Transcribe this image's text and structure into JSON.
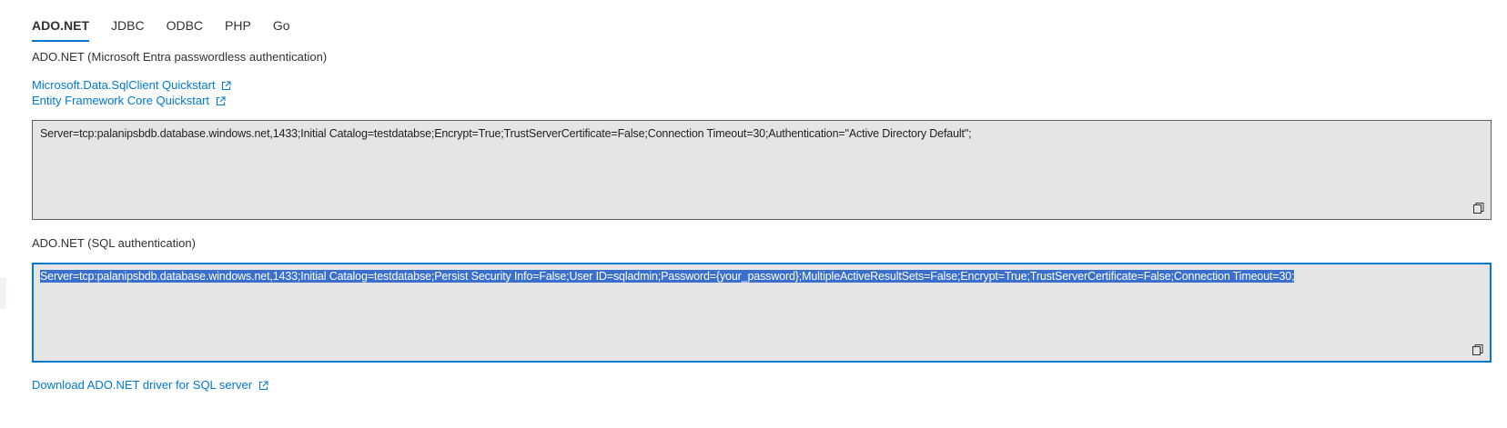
{
  "tabs": [
    {
      "label": "ADO.NET",
      "active": true
    },
    {
      "label": "JDBC",
      "active": false
    },
    {
      "label": "ODBC",
      "active": false
    },
    {
      "label": "PHP",
      "active": false
    },
    {
      "label": "Go",
      "active": false
    }
  ],
  "section1": {
    "heading": "ADO.NET (Microsoft Entra passwordless authentication)",
    "links": [
      {
        "label": "Microsoft.Data.SqlClient Quickstart",
        "icon": "external-link-icon"
      },
      {
        "label": "Entity Framework Core Quickstart",
        "icon": "external-link-icon"
      }
    ],
    "connection_string": "Server=tcp:palanipsbdb.database.windows.net,1433;Initial Catalog=testdatabse;Encrypt=True;TrustServerCertificate=False;Connection Timeout=30;Authentication=\"Active Directory Default\";",
    "copy_icon": "copy-icon"
  },
  "section2": {
    "heading": "ADO.NET (SQL authentication)",
    "connection_string": "Server=tcp:palanipsbdb.database.windows.net,1433;Initial Catalog=testdatabse;Persist Security Info=False;User ID=sqladmin;Password={your_password};MultipleActiveResultSets=False;Encrypt=True;TrustServerCertificate=False;Connection Timeout=30;",
    "selected": true,
    "copy_icon": "copy-icon"
  },
  "footer": {
    "download_link": "Download ADO.NET driver for SQL server",
    "icon": "external-link-icon"
  },
  "colors": {
    "accent": "#0078d4",
    "selection": "#3b6fce",
    "box_bg": "#e5e5e5"
  }
}
